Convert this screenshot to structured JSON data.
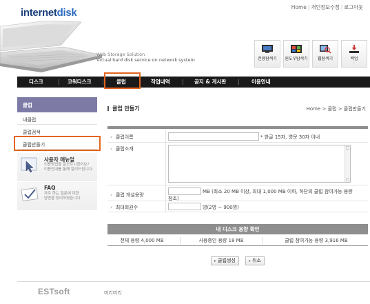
{
  "header": {
    "logo_a": "internet",
    "logo_b": "disk",
    "top_links": [
      "Home",
      "개인정보수정",
      "로그아웃"
    ],
    "tagline_1": "Web Storage Solution",
    "tagline_2": "Virtual hard disk service on network system",
    "tools": [
      {
        "label": "전용탐색기",
        "icon": "monitor-icon"
      },
      {
        "label": "윈도우탐색기",
        "icon": "window-icon"
      },
      {
        "label": "웹탐색기",
        "icon": "web-search-icon"
      },
      {
        "label": "백업",
        "icon": "backup-icon"
      }
    ],
    "tool_dot": "·"
  },
  "nav": {
    "items": [
      "디스크",
      "코워디스크",
      "클럽",
      "작업내역",
      "공지 & 게시판",
      "이용안내"
    ],
    "active": "클럽"
  },
  "sidebar": {
    "title": "클럽",
    "items": [
      "내클럽",
      "클럽검색",
      "클럽만들기"
    ],
    "active": "클럽만들기",
    "help": [
      {
        "title": "사용자 매뉴얼",
        "desc1": "이용방법을 잘모르시겠어요?",
        "desc2": "이용안내를 통해 알려드립니다."
      },
      {
        "title": "FAQ",
        "desc1": "자주 하는 질문에 대한",
        "desc2": "답변을 정리하였습니다."
      }
    ]
  },
  "main": {
    "title": "클럽 만들기",
    "breadcrumb": "Home > 클럽 > 클럽만들기",
    "form": {
      "name_label": "클럽이름",
      "name_value": "",
      "name_hint": "* 한글 15자, 영문 30자 이내",
      "intro_label": "클럽소개",
      "intro_value": "",
      "capacity_label": "클럽 개설용량",
      "capacity_value": "",
      "capacity_hint_1": "MB (최소 20 MB 이상, 최대 1,000 MB 이하, 하단의 클럽 참여가능 용량",
      "capacity_hint_2": "참조)",
      "members_label": "최대회원수",
      "members_value": "",
      "members_hint": "명(2명 ~ 900명)"
    },
    "disk": {
      "header": "내 디스크 용량 확인",
      "total": "전체 용량 4,000 MB",
      "used": "사용중인 용량 18 MB",
      "available": "클럽 참여가능 용량 3,916 MB"
    },
    "buttons": {
      "create": "클럽생성",
      "cancel": "취소"
    }
  },
  "footer": {
    "brand": "ESTsoft",
    "text": "머리머리"
  },
  "colors": {
    "highlight": "#e3641e",
    "sidebar_head": "#7d7ba6",
    "nav_bg": "#1a1a1a"
  }
}
